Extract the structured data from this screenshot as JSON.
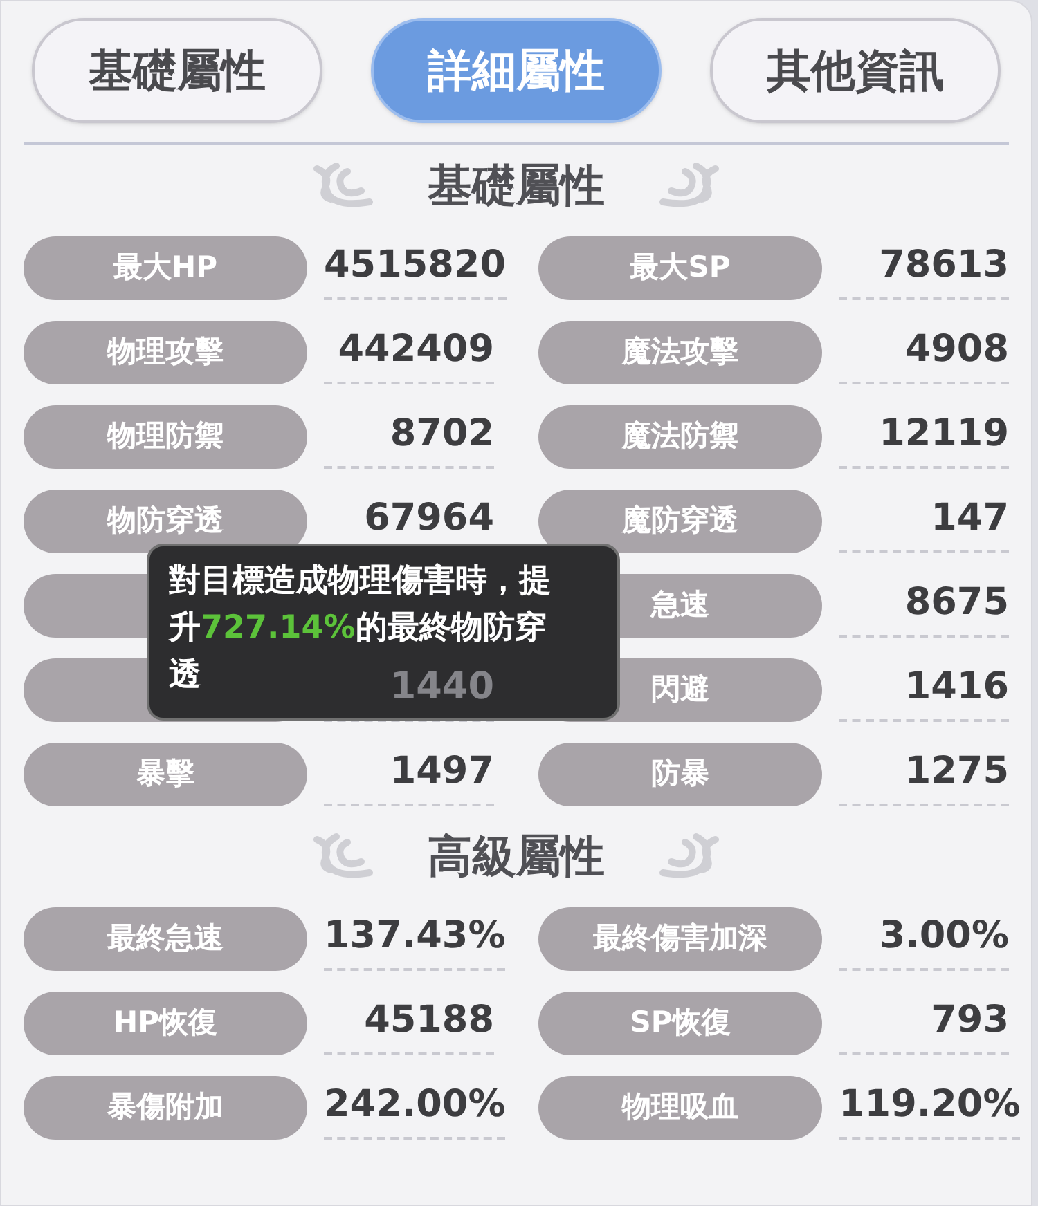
{
  "tabs": [
    {
      "label": "基礎屬性",
      "selected": false
    },
    {
      "label": "詳細屬性",
      "selected": true
    },
    {
      "label": "其他資訊",
      "selected": false
    }
  ],
  "sections": [
    {
      "title": "基礎屬性",
      "stats": [
        {
          "kind": "stat",
          "label": "最大HP",
          "value": "4515820"
        },
        {
          "kind": "stat",
          "label": "最大SP",
          "value": "78613"
        },
        {
          "kind": "stat",
          "label": "物理攻擊",
          "value": "442409"
        },
        {
          "kind": "stat",
          "label": "魔法攻擊",
          "value": "4908"
        },
        {
          "kind": "stat",
          "label": "物理防禦",
          "value": "8702"
        },
        {
          "kind": "stat",
          "label": "魔法防禦",
          "value": "12119"
        },
        {
          "kind": "stat",
          "label": "物防穿透",
          "value": "67964"
        },
        {
          "kind": "stat",
          "label": "魔防穿透",
          "value": "147"
        },
        {
          "kind": "covered"
        },
        {
          "kind": "stat",
          "label": "急速",
          "value": "8675"
        },
        {
          "kind": "covered",
          "value": "1440"
        },
        {
          "kind": "stat",
          "label": "閃避",
          "value": "1416"
        },
        {
          "kind": "stat",
          "label": "暴擊",
          "value": "1497"
        },
        {
          "kind": "stat",
          "label": "防暴",
          "value": "1275"
        }
      ]
    },
    {
      "title": "高級屬性",
      "stats": [
        {
          "kind": "stat",
          "label": "最終急速",
          "value": "137.43%"
        },
        {
          "kind": "stat",
          "label": "最終傷害加深",
          "value": "3.00%"
        },
        {
          "kind": "stat",
          "label": "HP恢復",
          "value": "45188"
        },
        {
          "kind": "stat",
          "label": "SP恢復",
          "value": "793"
        },
        {
          "kind": "stat",
          "label": "暴傷附加",
          "value": "242.00%"
        },
        {
          "kind": "stat",
          "label": "物理吸血",
          "value": "119.20%"
        }
      ]
    }
  ],
  "tooltip": {
    "segments": [
      {
        "text": "對目標造成物理傷害時，提升",
        "highlight": false
      },
      {
        "text": "727.14%",
        "highlight": true
      },
      {
        "text": "的最終物防穿透",
        "highlight": false
      }
    ]
  }
}
